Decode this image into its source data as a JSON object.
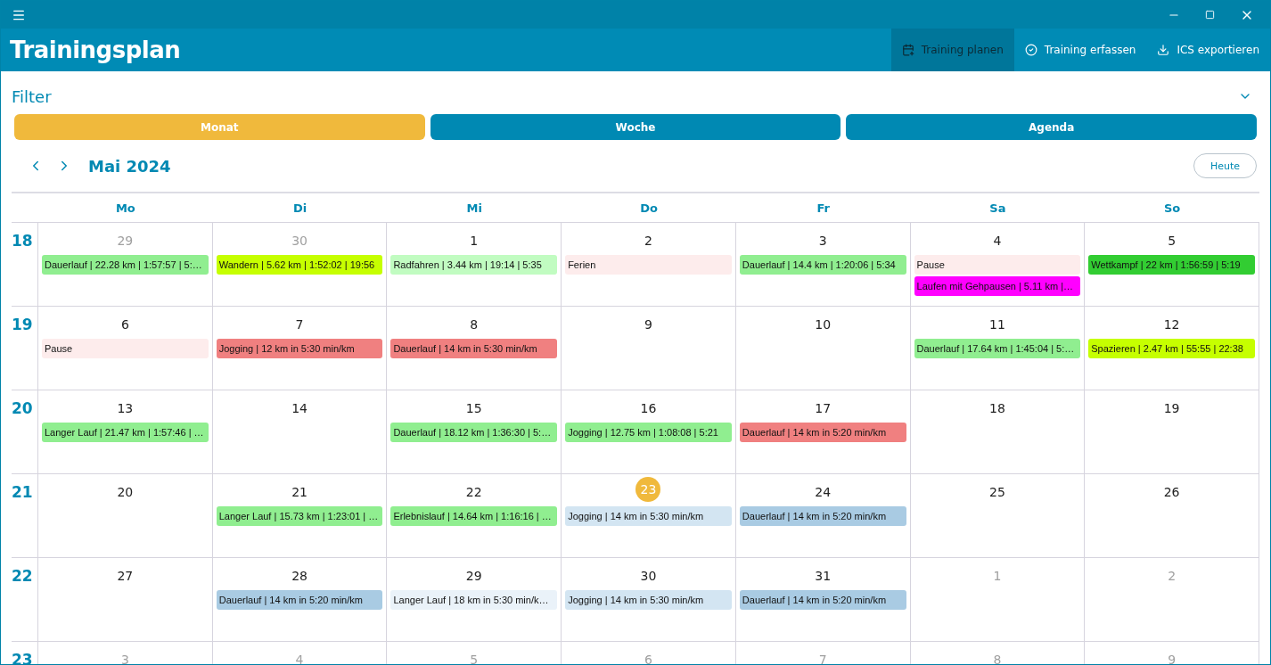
{
  "app": {
    "title": "Trainingsplan"
  },
  "commands": [
    {
      "label": "Training planen",
      "selected": true
    },
    {
      "label": "Training erfassen",
      "selected": false
    },
    {
      "label": "ICS exportieren",
      "selected": false
    }
  ],
  "filter": {
    "label": "Filter",
    "expanded": false
  },
  "views": [
    {
      "label": "Monat",
      "selected": true
    },
    {
      "label": "Woche",
      "selected": false
    },
    {
      "label": "Agenda",
      "selected": false
    }
  ],
  "month": "Mai 2024",
  "today_button": "Heute",
  "weekdays": [
    "Mo",
    "Di",
    "Mi",
    "Do",
    "Fr",
    "Sa",
    "So"
  ],
  "weeks": [
    {
      "number": "18",
      "days": [
        {
          "day": "29",
          "outside": true,
          "today": false,
          "events": [
            {
              "text": "Dauerlauf | 22.28 km | 1:57:57 | 5:…",
              "color": "#90ee90"
            }
          ]
        },
        {
          "day": "30",
          "outside": true,
          "today": false,
          "events": [
            {
              "text": "Wandern | 5.62 km | 1:52:02 | 19:56",
              "color": "#c6ff00"
            }
          ]
        },
        {
          "day": "1",
          "outside": false,
          "today": false,
          "events": [
            {
              "text": "Radfahren | 3.44 km | 19:14 | 5:35",
              "color": "#c1fcc1"
            }
          ]
        },
        {
          "day": "2",
          "outside": false,
          "today": false,
          "events": [
            {
              "text": "Ferien",
              "color": "#fdecec"
            }
          ]
        },
        {
          "day": "3",
          "outside": false,
          "today": false,
          "events": [
            {
              "text": "Dauerlauf | 14.4 km | 1:20:06 | 5:34",
              "color": "#90ee90"
            }
          ]
        },
        {
          "day": "4",
          "outside": false,
          "today": false,
          "events": [
            {
              "text": "Pause",
              "color": "#fdecec"
            },
            {
              "text": "Laufen mit Gehpausen | 5.11 km |…",
              "color": "#ff00ff"
            }
          ]
        },
        {
          "day": "5",
          "outside": false,
          "today": false,
          "events": [
            {
              "text": "Wettkampf | 22 km | 1:56:59 | 5:19",
              "color": "#32cd32"
            }
          ]
        }
      ]
    },
    {
      "number": "19",
      "days": [
        {
          "day": "6",
          "outside": false,
          "today": false,
          "events": [
            {
              "text": "Pause",
              "color": "#fdecec"
            }
          ]
        },
        {
          "day": "7",
          "outside": false,
          "today": false,
          "events": [
            {
              "text": "Jogging | 12 km in 5:30 min/km",
              "color": "#f08080"
            }
          ]
        },
        {
          "day": "8",
          "outside": false,
          "today": false,
          "events": [
            {
              "text": "Dauerlauf | 14 km in 5:30 min/km",
              "color": "#f08080"
            }
          ]
        },
        {
          "day": "9",
          "outside": false,
          "today": false
        },
        {
          "day": "10",
          "outside": false,
          "today": false
        },
        {
          "day": "11",
          "outside": false,
          "today": false,
          "events": [
            {
              "text": "Dauerlauf | 17.64 km | 1:45:04 | 5:…",
              "color": "#90ee90"
            }
          ]
        },
        {
          "day": "12",
          "outside": false,
          "today": false,
          "events": [
            {
              "text": "Spazieren | 2.47 km | 55:55 | 22:38",
              "color": "#c6ff00"
            }
          ]
        }
      ]
    },
    {
      "number": "20",
      "days": [
        {
          "day": "13",
          "outside": false,
          "today": false,
          "events": [
            {
              "text": "Langer Lauf | 21.47 km | 1:57:46 | …",
              "color": "#90ee90"
            }
          ]
        },
        {
          "day": "14",
          "outside": false,
          "today": false
        },
        {
          "day": "15",
          "outside": false,
          "today": false,
          "events": [
            {
              "text": "Dauerlauf | 18.12 km | 1:36:30 | 5:…",
              "color": "#90ee90"
            }
          ]
        },
        {
          "day": "16",
          "outside": false,
          "today": false,
          "events": [
            {
              "text": "Jogging | 12.75 km | 1:08:08 | 5:21",
              "color": "#90ee90"
            }
          ]
        },
        {
          "day": "17",
          "outside": false,
          "today": false,
          "events": [
            {
              "text": "Dauerlauf | 14 km in 5:20 min/km",
              "color": "#f08080"
            }
          ]
        },
        {
          "day": "18",
          "outside": false,
          "today": false
        },
        {
          "day": "19",
          "outside": false,
          "today": false
        }
      ]
    },
    {
      "number": "21",
      "days": [
        {
          "day": "20",
          "outside": false,
          "today": false
        },
        {
          "day": "21",
          "outside": false,
          "today": false,
          "events": [
            {
              "text": "Langer Lauf | 15.73 km | 1:23:01 | …",
              "color": "#90ee90"
            }
          ]
        },
        {
          "day": "22",
          "outside": false,
          "today": false,
          "events": [
            {
              "text": "Erlebnislauf | 14.64 km | 1:16:16 | …",
              "color": "#90ee90"
            }
          ]
        },
        {
          "day": "23",
          "outside": false,
          "today": true,
          "events": [
            {
              "text": "Jogging | 14 km in 5:30 min/km",
              "color": "#d3e5f2"
            }
          ]
        },
        {
          "day": "24",
          "outside": false,
          "today": false,
          "events": [
            {
              "text": "Dauerlauf | 14 km in 5:20 min/km",
              "color": "#a9cbe3"
            }
          ]
        },
        {
          "day": "25",
          "outside": false,
          "today": false
        },
        {
          "day": "26",
          "outside": false,
          "today": false
        }
      ]
    },
    {
      "number": "22",
      "days": [
        {
          "day": "27",
          "outside": false,
          "today": false
        },
        {
          "day": "28",
          "outside": false,
          "today": false,
          "events": [
            {
              "text": "Dauerlauf | 14 km in 5:20 min/km",
              "color": "#a9cbe3"
            }
          ]
        },
        {
          "day": "29",
          "outside": false,
          "today": false,
          "events": [
            {
              "text": "Langer Lauf | 18 km in 5:30 min/k…",
              "color": "#eaf2f9"
            }
          ]
        },
        {
          "day": "30",
          "outside": false,
          "today": false,
          "events": [
            {
              "text": "Jogging | 14 km in 5:30 min/km",
              "color": "#d3e5f2"
            }
          ]
        },
        {
          "day": "31",
          "outside": false,
          "today": false,
          "events": [
            {
              "text": "Dauerlauf | 14 km in 5:20 min/km",
              "color": "#a9cbe3"
            }
          ]
        },
        {
          "day": "1",
          "outside": true,
          "today": false
        },
        {
          "day": "2",
          "outside": true,
          "today": false
        }
      ]
    },
    {
      "number": "23",
      "days": [
        {
          "day": "3",
          "outside": true,
          "today": false
        },
        {
          "day": "4",
          "outside": true,
          "today": false
        },
        {
          "day": "5",
          "outside": true,
          "today": false
        },
        {
          "day": "6",
          "outside": true,
          "today": false
        },
        {
          "day": "7",
          "outside": true,
          "today": false
        },
        {
          "day": "8",
          "outside": true,
          "today": false
        },
        {
          "day": "9",
          "outside": true,
          "today": false
        }
      ]
    }
  ]
}
